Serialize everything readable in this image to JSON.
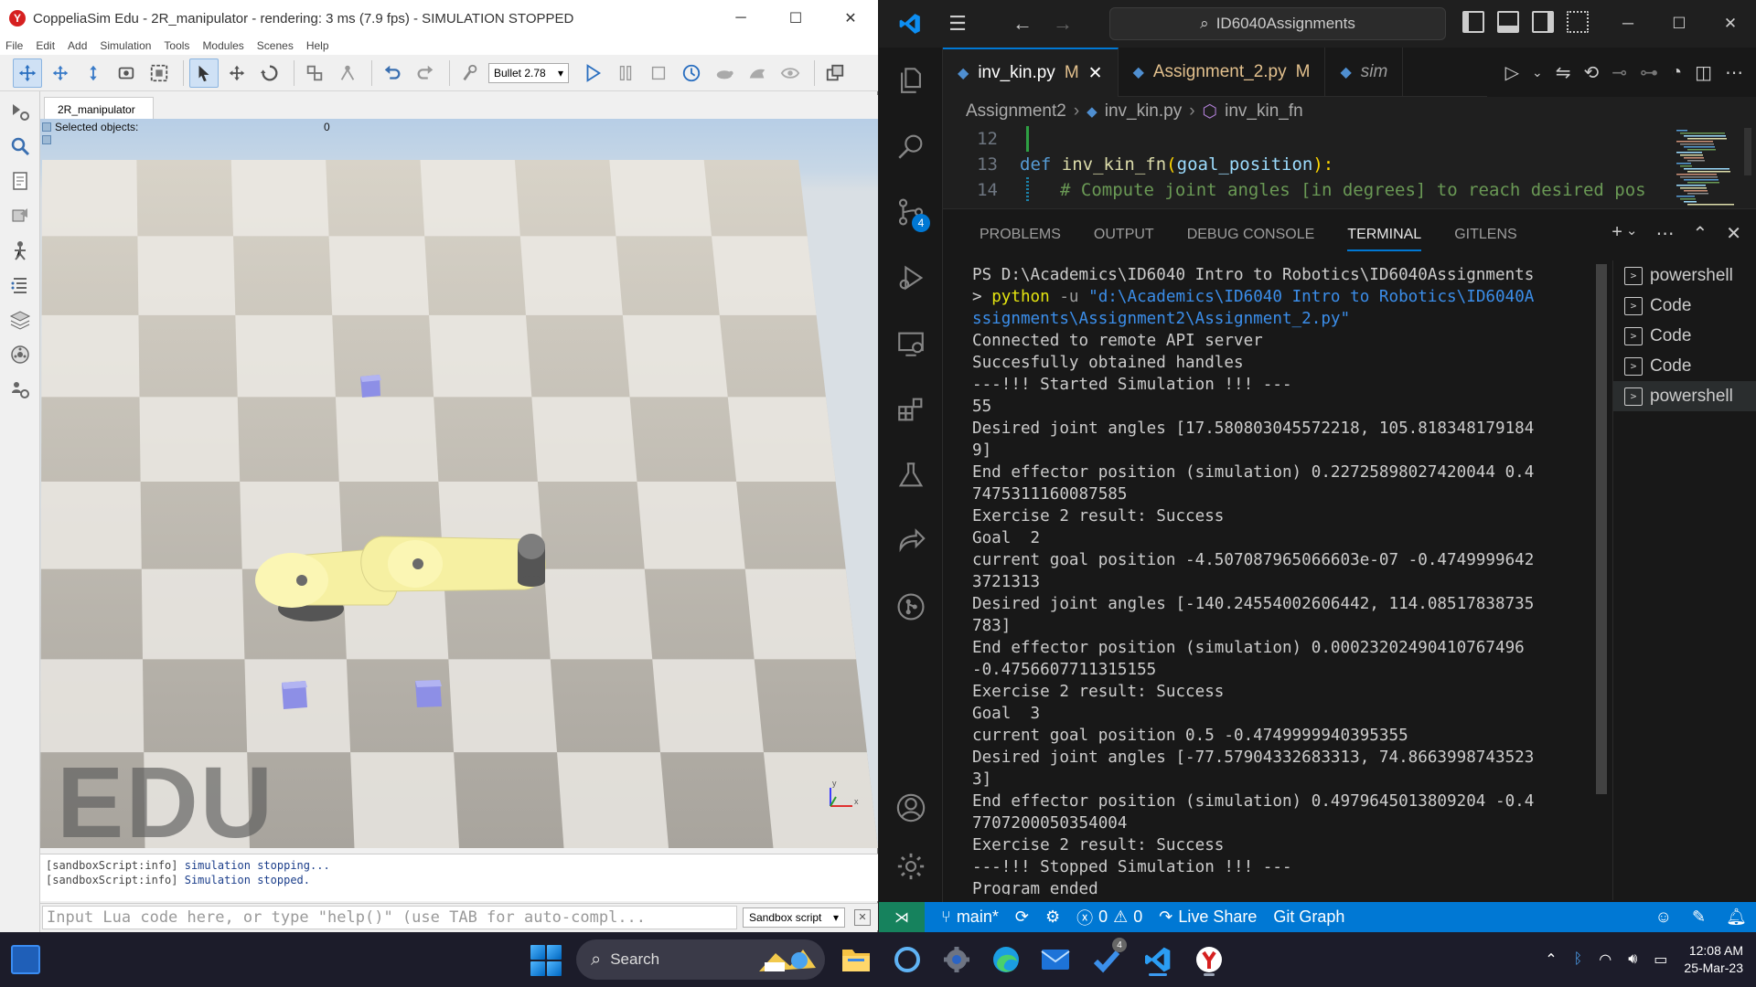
{
  "coppelia": {
    "title": "CoppeliaSim Edu - 2R_manipulator - rendering: 3 ms (7.9 fps) - SIMULATION STOPPED",
    "menu": [
      "File",
      "Edit",
      "Add",
      "Simulation",
      "Tools",
      "Modules",
      "Scenes",
      "Help"
    ],
    "physics_engine": "Bullet 2.78",
    "scene_tab": "2R_manipulator",
    "selected_label": "Selected objects:",
    "selected_count": "0",
    "watermark": "EDU",
    "axes": {
      "x": "x",
      "y": "y"
    },
    "console_lines": [
      {
        "tag": "[sandboxScript:info]",
        "msg": "simulation stopping..."
      },
      {
        "tag": "[sandboxScript:info]",
        "msg": "Simulation stopped."
      }
    ],
    "lua_placeholder": "Input Lua code here, or type \"help()\" (use TAB for auto-compl...",
    "script_select": "Sandbox script"
  },
  "vscode": {
    "command_center": "ID6040Assignments",
    "tabs": [
      {
        "label": "inv_kin.py",
        "status": "M",
        "active": true
      },
      {
        "label": "Assignment_2.py",
        "status": "M",
        "active": false
      },
      {
        "label": "sim",
        "status": "",
        "active": false
      }
    ],
    "breadcrumb": [
      "Assignment2",
      "inv_kin.py",
      "inv_kin_fn"
    ],
    "editor_lines": [
      {
        "num": "12",
        "text": ""
      },
      {
        "num": "13",
        "kw": "def",
        "fn": "inv_kin_fn",
        "param": "goal_position",
        "tail": "):"
      },
      {
        "num": "14",
        "comment": "# Compute joint angles [in degrees] to reach desired pos"
      }
    ],
    "panel_tabs": [
      "PROBLEMS",
      "OUTPUT",
      "DEBUG CONSOLE",
      "TERMINAL",
      "GITLENS"
    ],
    "active_panel_tab": "TERMINAL",
    "terminal": {
      "prompt": "PS D:\\Academics\\ID6040 Intro to Robotics\\ID6040Assignments",
      "cmd_prefix": "> ",
      "cmd": "python",
      "flag": " -u ",
      "path1": "\"d:\\Academics\\ID6040 Intro to Robotics\\ID6040A",
      "path2": "ssignments\\Assignment2\\Assignment_2.py\"",
      "lines": [
        "Connected to remote API server",
        "Succesfully obtained handles",
        "---!!! Started Simulation !!! ---",
        "55",
        "Desired joint angles [17.580803045572218, 105.818348179184",
        "9]",
        "End effector position (simulation) 0.22725898027420044 0.4",
        "7475311160087585",
        "Exercise 2 result: Success",
        "Goal  2",
        "current goal position -4.507087965066603e-07 -0.4749999642",
        "3721313",
        "Desired joint angles [-140.24554002606442, 114.08517838735",
        "783]",
        "End effector position (simulation) 0.00023202490410767496",
        "-0.4756607711315155",
        "Exercise 2 result: Success",
        "Goal  3",
        "current goal position 0.5 -0.4749999940395355",
        "Desired joint angles [-77.57904332683313, 74.8663998743523",
        "3]",
        "End effector position (simulation) 0.4979645013809204 -0.4",
        "7707200050354004",
        "Exercise 2 result: Success",
        "---!!! Stopped Simulation !!! ---",
        "Program ended"
      ]
    },
    "terminal_list": [
      "powershell",
      "Code",
      "Code",
      "Code",
      "powershell"
    ],
    "status": {
      "branch": "main*",
      "errors": "0",
      "warnings": "0",
      "live_share": "Live Share",
      "git_graph": "Git Graph"
    },
    "source_control_badge": "4"
  },
  "taskbar": {
    "search": "Search",
    "badge": "4",
    "time": "12:08 AM",
    "date": "25-Mar-23"
  }
}
